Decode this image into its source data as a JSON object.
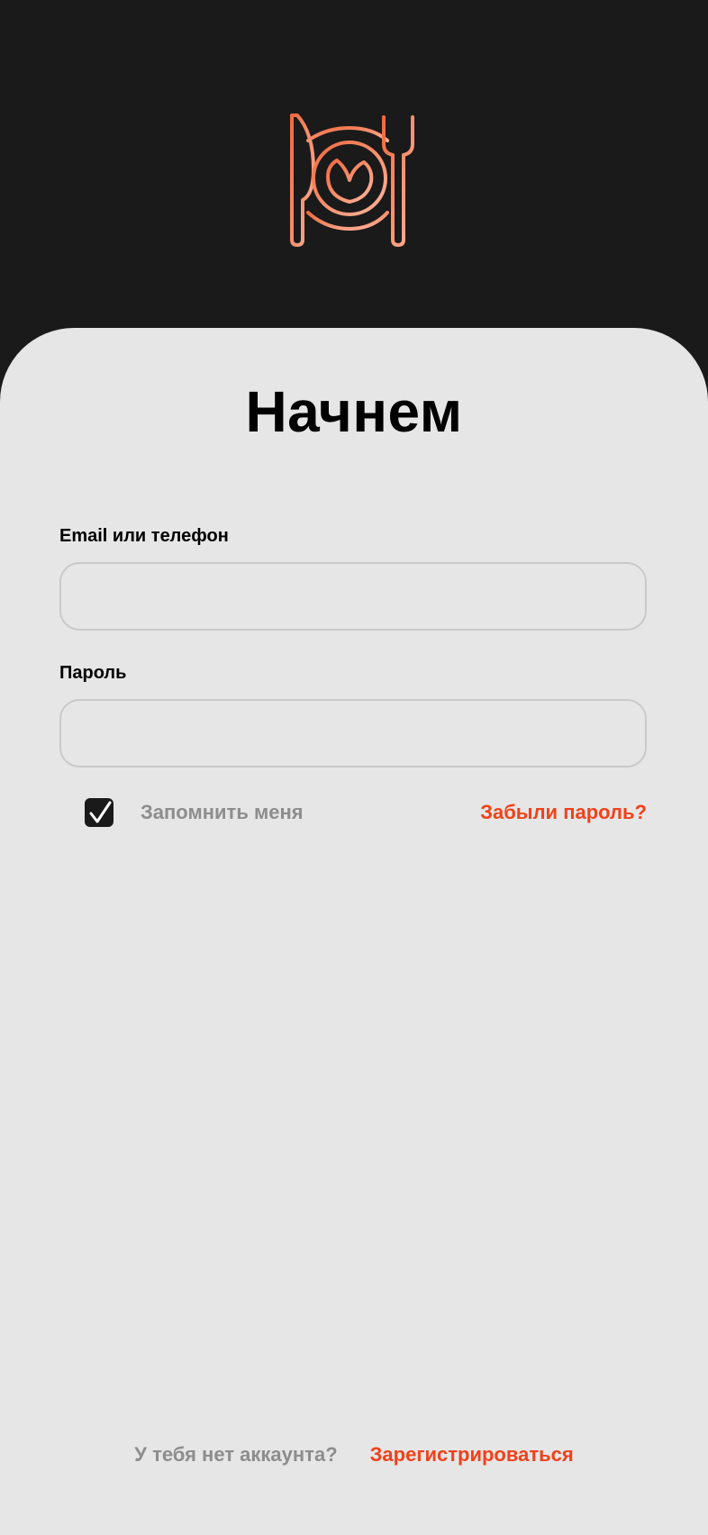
{
  "logo": {
    "icon": "plate-fork-knife-icon",
    "colors": [
      "#f06a3f",
      "#ffb49b"
    ]
  },
  "title": "Начнем",
  "form": {
    "email_label": "Email или телефон",
    "email_value": "",
    "email_placeholder": "",
    "password_label": "Пароль",
    "password_value": "",
    "password_placeholder": "",
    "remember_checked": true,
    "remember_label": "Запомнить меня",
    "forgot_link": "Забыли пароль?"
  },
  "footer": {
    "no_account_text": "У тебя нет аккаунта?",
    "register_link": "Зарегистрироваться"
  },
  "colors": {
    "background_dark": "#1a1a1a",
    "card": "#e6e6e6",
    "accent": "#f2411a",
    "muted_text": "#8d8d8d"
  }
}
